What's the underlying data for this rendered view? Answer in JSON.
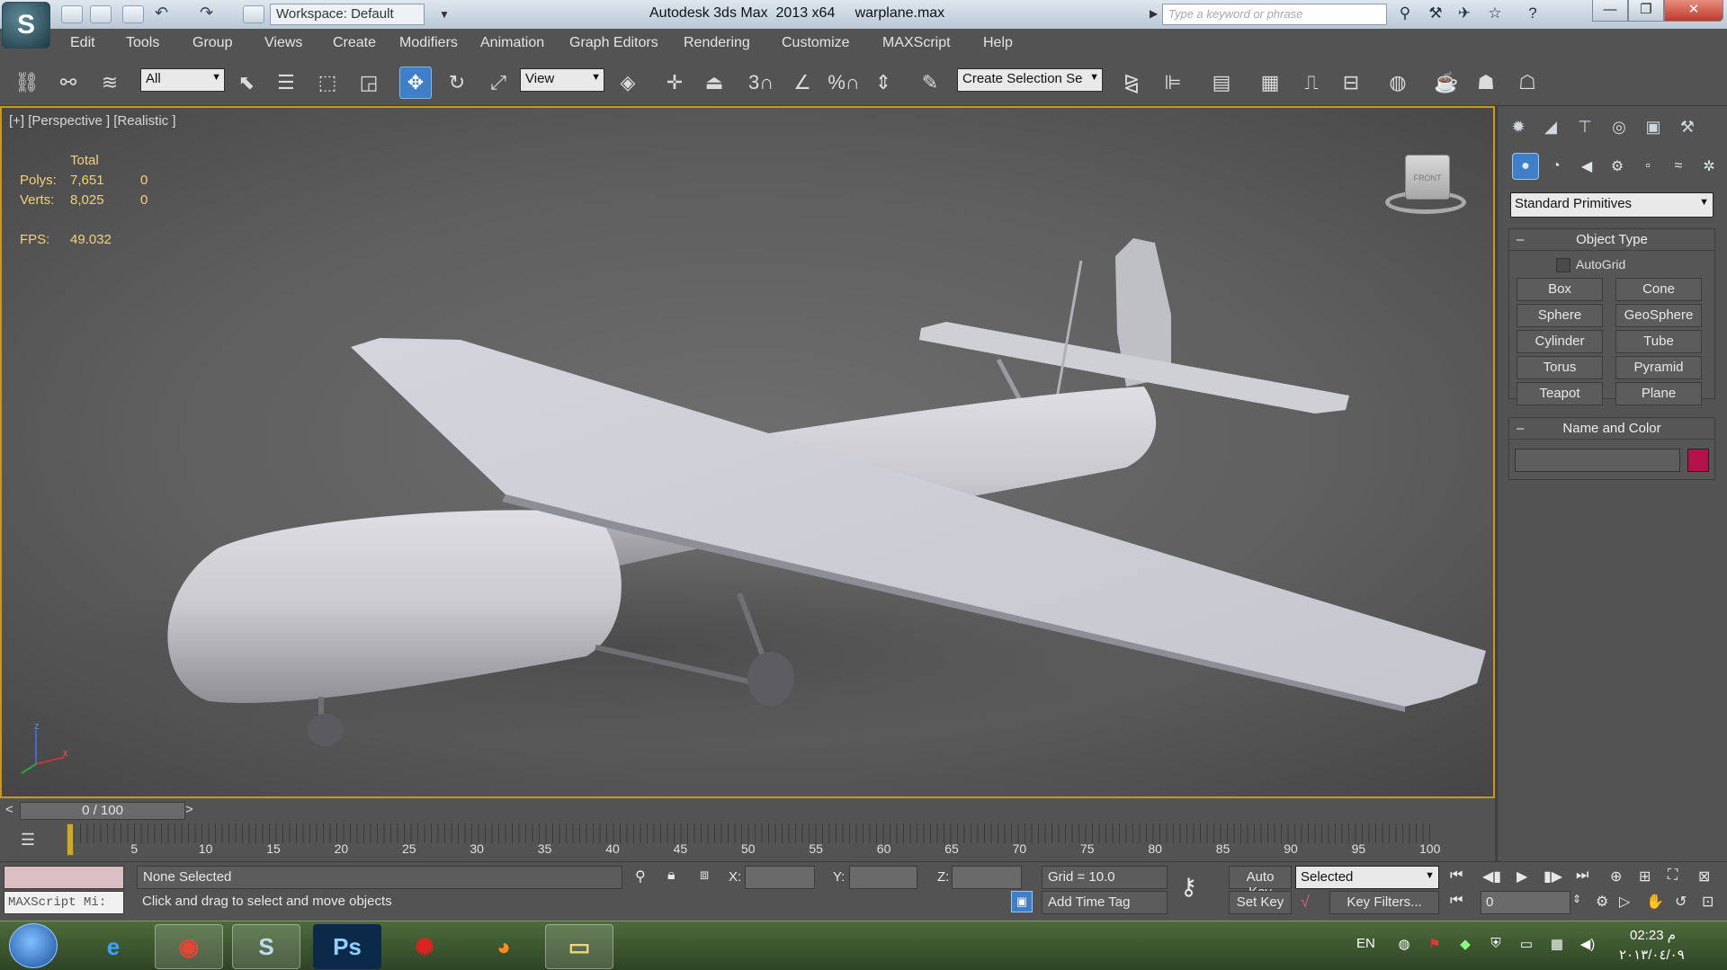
{
  "window": {
    "title": "Autodesk 3ds Max  2013 x64     warplane.max",
    "workspace": "Workspace: Default",
    "search_placeholder": "Type a keyword or phrase",
    "minimize": "—",
    "maximize": "❐",
    "close": "✕"
  },
  "menu": {
    "items": [
      "Edit",
      "Tools",
      "Group",
      "Views",
      "Create",
      "Modifiers",
      "Animation",
      "Graph Editors",
      "Rendering",
      "Customize",
      "MAXScript",
      "Help"
    ]
  },
  "toolbar": {
    "selection_filter": "All",
    "ref_coord": "View",
    "named_selection": "Create Selection Se",
    "snap_angle_label": "3",
    "percent_snap_label": "%"
  },
  "viewport": {
    "label": "[+] [Perspective ] [Realistic ]",
    "stats": {
      "header": "Total",
      "polys_label": "Polys:",
      "polys_total": "7,651",
      "polys_sel": "0",
      "verts_label": "Verts:",
      "verts_total": "8,025",
      "verts_sel": "0",
      "fps_label": "FPS:",
      "fps_value": "49.032"
    },
    "viewcube_label": "FRONT",
    "axis": {
      "z": "z",
      "x": "x"
    }
  },
  "command_panel": {
    "primitive_type": "Standard Primitives",
    "object_type_title": "Object Type",
    "autogrid_label": "AutoGrid",
    "buttons": [
      "Box",
      "Cone",
      "Sphere",
      "GeoSphere",
      "Cylinder",
      "Tube",
      "Torus",
      "Pyramid",
      "Teapot",
      "Plane"
    ],
    "name_color_title": "Name and Color",
    "object_color": "#b3134a"
  },
  "timeline": {
    "frame_display": "0 / 100",
    "prev": "<",
    "next": ">",
    "ticks": [
      "5",
      "10",
      "15",
      "20",
      "25",
      "30",
      "35",
      "40",
      "45",
      "50",
      "55",
      "60",
      "65",
      "70",
      "75",
      "80",
      "85",
      "90",
      "95",
      "100"
    ]
  },
  "status": {
    "maxscript_label": "MAXScript Mi:",
    "selection_status": "None Selected",
    "prompt": "Click and drag to select and move objects",
    "x_label": "X:",
    "y_label": "Y:",
    "z_label": "Z:",
    "grid": "Grid = 10.0",
    "add_time_tag": "Add Time Tag",
    "auto_key": "Auto Key",
    "set_key": "Set Key",
    "key_mode": "Selected",
    "key_filters": "Key Filters...",
    "current_frame": "0"
  },
  "taskbar": {
    "lang": "EN",
    "time": "02:23 م",
    "date": "٢٠١٣/٠٤/٠٩"
  }
}
